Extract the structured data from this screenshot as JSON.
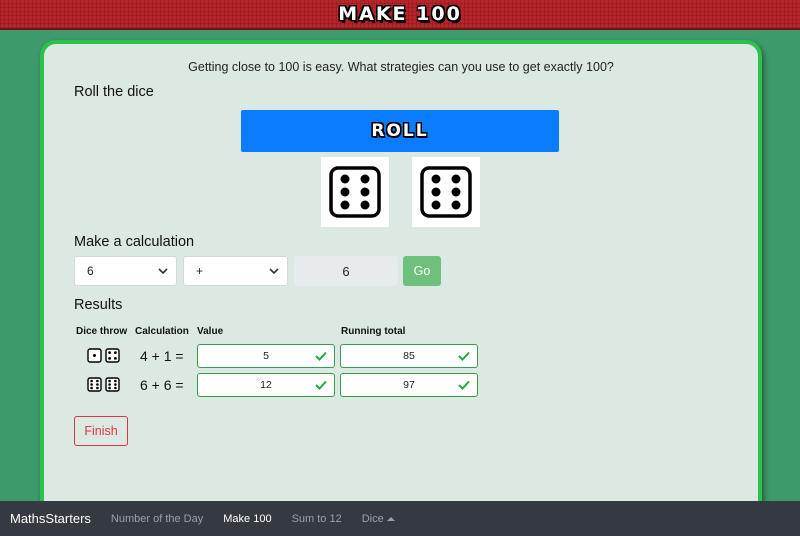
{
  "header": {
    "title": "MAKE 100"
  },
  "intro": "Getting close to 100 is easy. What strategies can you use to get exactly 100?",
  "roll_section": {
    "heading": "Roll the dice",
    "button_label": "ROLL",
    "dice": [
      6,
      6
    ]
  },
  "calc_section": {
    "heading": "Make a calculation",
    "number_select": "6",
    "operator_select": "+",
    "result": "6",
    "go_label": "Go"
  },
  "results_section": {
    "heading": "Results",
    "columns": [
      "Dice throw",
      "Calculation",
      "Value",
      "Running total"
    ],
    "rows": [
      {
        "dice": [
          1,
          4
        ],
        "calculation": "4 + 1 =",
        "value": "5",
        "total": "85"
      },
      {
        "dice": [
          6,
          6
        ],
        "calculation": "6 + 6 =",
        "value": "12",
        "total": "97"
      }
    ]
  },
  "finish_label": "Finish",
  "navbar": {
    "brand": "MathsStarters",
    "links": [
      "Number of the Day",
      "Make 100",
      "Sum to 12",
      "Dice"
    ],
    "active": "Make 100"
  },
  "colors": {
    "accent_green": "#2cc04f",
    "roll_blue": "#0a7cff",
    "finish_red": "#dc3545",
    "header_red": "#b8242b"
  },
  "icons": {
    "valid": "check-icon",
    "select_arrow": "chevron-down-icon",
    "dropdown_caret": "caret-up-icon"
  }
}
